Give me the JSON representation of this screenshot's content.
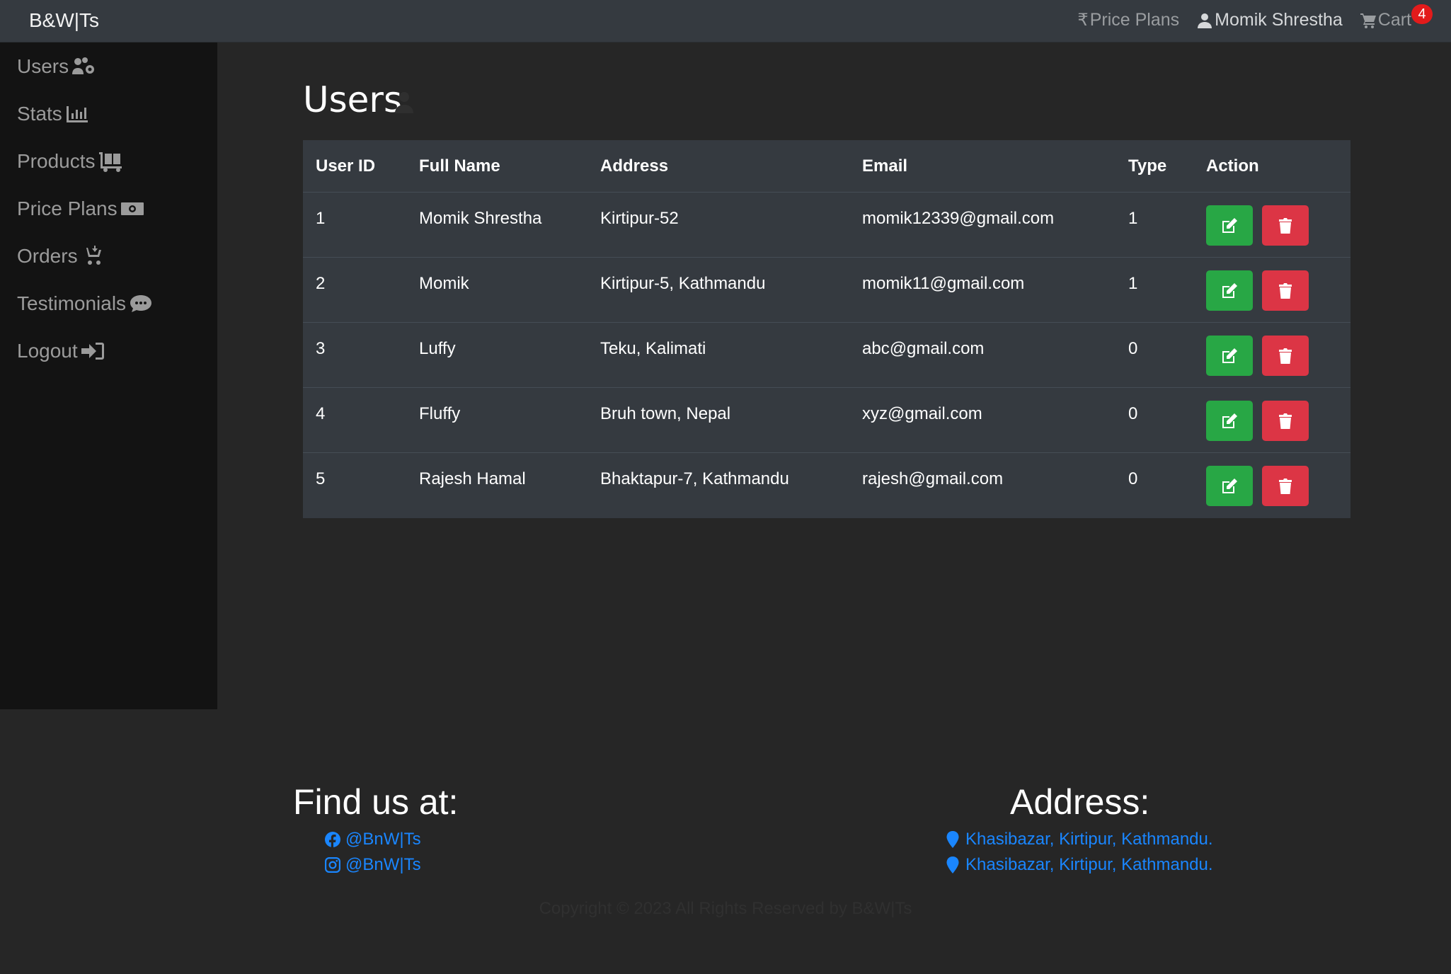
{
  "navbar": {
    "brand": "B&W|Ts",
    "price_plans": "Price Plans",
    "user_name": "Momik Shrestha",
    "cart": "Cart",
    "cart_count": "4"
  },
  "sidebar": {
    "items": [
      {
        "label": "Users",
        "icon": "users-cog-icon"
      },
      {
        "label": "Stats",
        "icon": "chart-bar-icon"
      },
      {
        "label": "Products",
        "icon": "dolly-flatbed-icon"
      },
      {
        "label": "Price Plans",
        "icon": "money-bill-icon"
      },
      {
        "label": "Orders",
        "icon": "cart-arrow-icon"
      },
      {
        "label": "Testimonials",
        "icon": "comment-icon"
      },
      {
        "label": "Logout",
        "icon": "sign-out-icon"
      }
    ]
  },
  "main": {
    "title": "Users",
    "table": {
      "headers": [
        "User ID",
        "Full Name",
        "Address",
        "Email",
        "Type",
        "Action"
      ],
      "rows": [
        {
          "id": "1",
          "name": "Momik Shrestha",
          "address": "Kirtipur-52",
          "email": "momik12339@gmail.com",
          "type": "1"
        },
        {
          "id": "2",
          "name": "Momik",
          "address": "Kirtipur-5, Kathmandu",
          "email": "momik11@gmail.com",
          "type": "1"
        },
        {
          "id": "3",
          "name": "Luffy",
          "address": "Teku, Kalimati",
          "email": "abc@gmail.com",
          "type": "0"
        },
        {
          "id": "4",
          "name": "Fluffy",
          "address": "Bruh town, Nepal",
          "email": "xyz@gmail.com",
          "type": "0"
        },
        {
          "id": "5",
          "name": "Rajesh Hamal",
          "address": "Bhaktapur-7, Kathmandu",
          "email": "rajesh@gmail.com",
          "type": "0"
        }
      ]
    }
  },
  "footer": {
    "find_title": "Find us at:",
    "facebook": "@BnW|Ts",
    "instagram": "@BnW|Ts",
    "address_title": "Address:",
    "address_1": "Khasibazar, Kirtipur, Kathmandu.",
    "address_2": "Khasibazar, Kirtipur, Kathmandu.",
    "copyright": "Copyright © 2023 All Rights Reserved by B&W|Ts"
  },
  "colors": {
    "edit": "#28a745",
    "delete": "#dc3545",
    "link": "#1a86ff",
    "badge": "#e31b1b"
  }
}
